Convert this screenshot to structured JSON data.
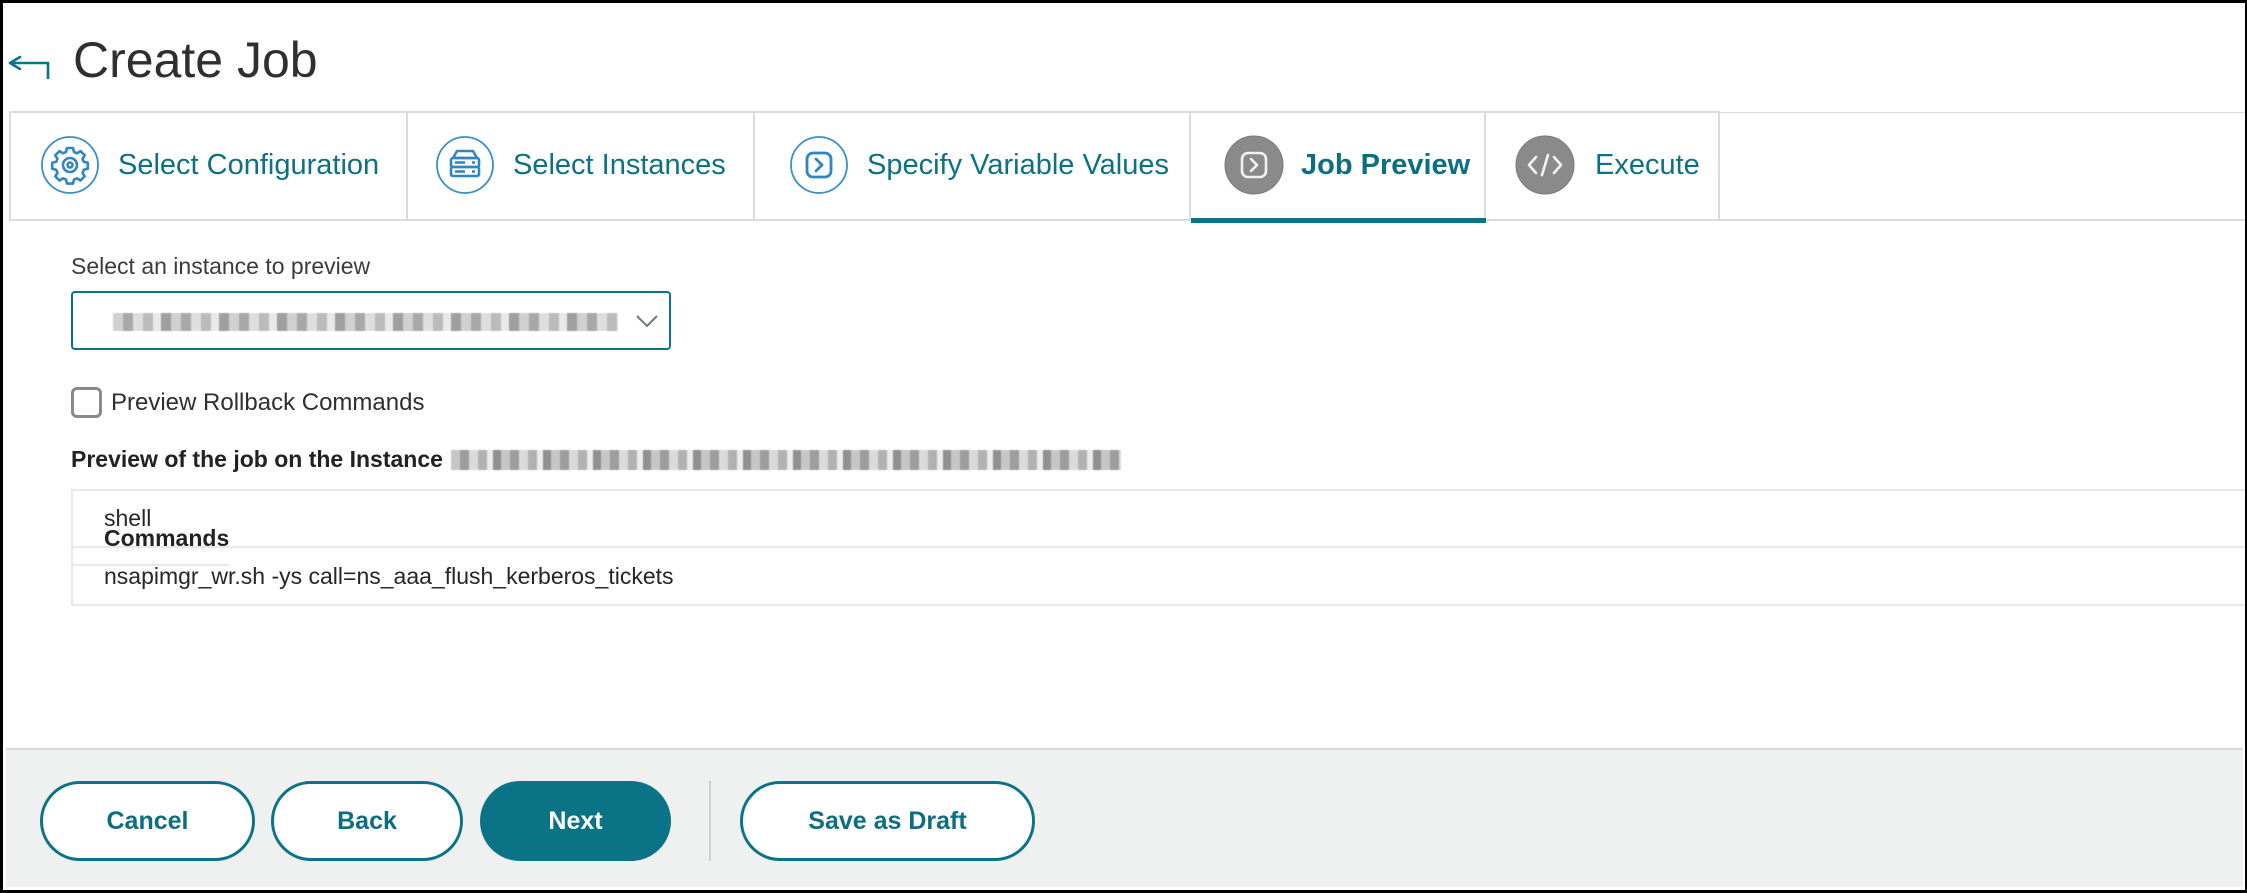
{
  "header": {
    "title": "Create Job",
    "back_icon": "back-arrow-icon"
  },
  "tabs": [
    {
      "label": "Select Configuration",
      "icon": "gear-icon",
      "state": "completed"
    },
    {
      "label": "Select Instances",
      "icon": "server-stack-icon",
      "state": "completed"
    },
    {
      "label": "Specify Variable Values",
      "icon": "chevron-right-square-icon",
      "state": "completed"
    },
    {
      "label": "Job Preview",
      "icon": "chevron-right-square-icon",
      "state": "active"
    },
    {
      "label": "Execute",
      "icon": "code-icon",
      "state": "pending"
    }
  ],
  "instance_select": {
    "label": "Select an instance to preview",
    "value": "[redacted instance name]",
    "redacted": true
  },
  "rollback_checkbox": {
    "label": "Preview Rollback Commands",
    "checked": false
  },
  "preview": {
    "heading": "Preview of the job on the Instance",
    "instance_redacted": true
  },
  "commands_table": {
    "header": "Commands",
    "rows": [
      "shell",
      "nsapimgr_wr.sh -ys call=ns_aaa_flush_kerberos_tickets"
    ]
  },
  "footer": {
    "cancel": "Cancel",
    "back": "Back",
    "next": "Next",
    "save_draft": "Save as Draft"
  },
  "colors": {
    "accent": "#0b7386",
    "inactive_icon": "#8a8a8a",
    "footer_bg": "#eff1f0"
  }
}
